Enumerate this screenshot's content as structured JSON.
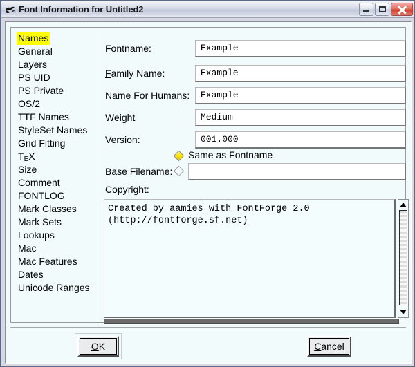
{
  "window": {
    "title": "Font Information for Untitled2",
    "icon": "fontforge-icon",
    "caption_buttons": [
      {
        "name": "minimize",
        "glyph": "minimize-icon"
      },
      {
        "name": "maximize",
        "glyph": "maximize-icon"
      },
      {
        "name": "close",
        "glyph": "close-icon"
      }
    ]
  },
  "sidebar": {
    "selected": "Names",
    "items": [
      {
        "label": "Names"
      },
      {
        "label": "General"
      },
      {
        "label": "Layers"
      },
      {
        "label": "PS UID"
      },
      {
        "label": "PS Private"
      },
      {
        "label": "OS/2"
      },
      {
        "label": "TTF Names"
      },
      {
        "label": "StyleSet Names"
      },
      {
        "label": "Grid Fitting"
      },
      {
        "label": "TeX"
      },
      {
        "label": "Size"
      },
      {
        "label": "Comment"
      },
      {
        "label": "FONTLOG"
      },
      {
        "label": "Mark Classes"
      },
      {
        "label": "Mark Sets"
      },
      {
        "label": "Lookups"
      },
      {
        "label": "Mac"
      },
      {
        "label": "Mac Features"
      },
      {
        "label": "Dates"
      },
      {
        "label": "Unicode Ranges"
      }
    ]
  },
  "form": {
    "fontname": {
      "label_pre": "Fo",
      "label_key": "nt",
      "label_post": "name:",
      "value": "Example",
      "placeholder": ""
    },
    "family_name": {
      "label_pre": "",
      "label_key": "F",
      "label_post": "amily Name:",
      "value": "Example",
      "placeholder": ""
    },
    "name_for_humans": {
      "label_pre": "Name For Human",
      "label_key": "s",
      "label_post": ":",
      "value": "Example",
      "placeholder": ""
    },
    "weight": {
      "label_pre": "",
      "label_key": "W",
      "label_post": "eight",
      "value": "Medium",
      "placeholder": ""
    },
    "version": {
      "label_pre": "",
      "label_key": "V",
      "label_post": "ersion:",
      "value": "001.000",
      "placeholder": ""
    },
    "same_as_fontname": {
      "label": "Same as Fontname",
      "selected": true
    },
    "base_filename": {
      "label_pre": "",
      "label_key": "B",
      "label_post": "ase Filename:",
      "value": "",
      "placeholder": "",
      "selected": false
    },
    "copyright": {
      "label_pre": "Copy",
      "label_key": "r",
      "label_post": "ight:",
      "text_before_caret": "Created by aamies",
      "text_after_caret": " with FontForge 2.0 (http://fontforge.sf.net)"
    }
  },
  "buttons": {
    "ok": {
      "label_pre": "",
      "label_key": "O",
      "label_post": "K",
      "default": true
    },
    "cancel": {
      "label_pre": "",
      "label_key": "C",
      "label_post": "ancel",
      "default": false
    }
  },
  "colors": {
    "highlight": "#ffff00",
    "dialog_bg": "#f2fbfb",
    "radio_on": "#ffe000",
    "close_button": "#cf4233"
  }
}
